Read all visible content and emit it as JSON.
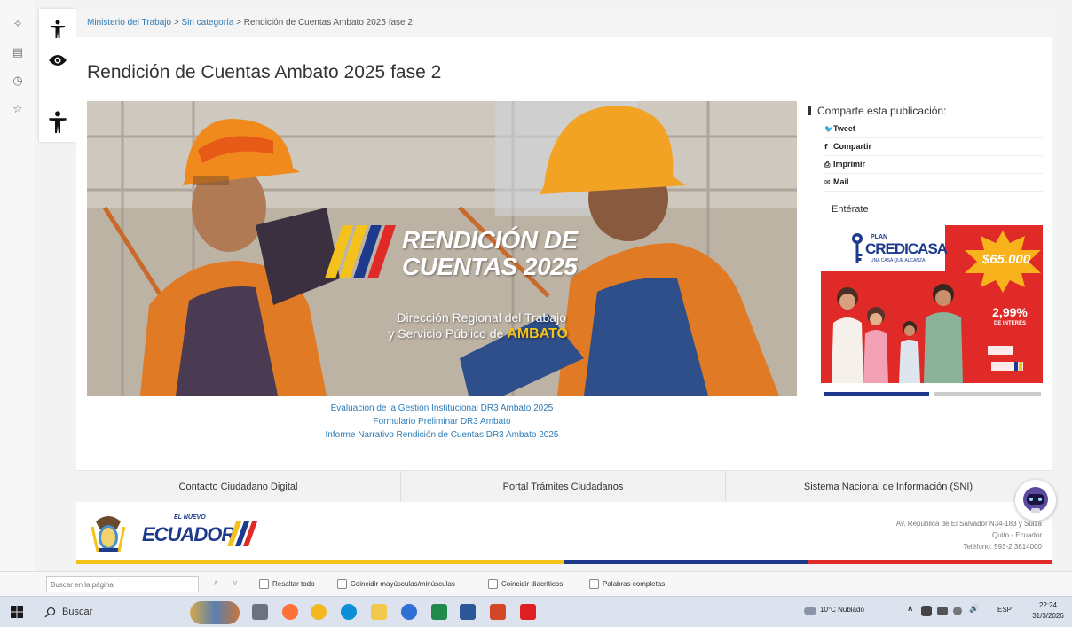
{
  "breadcrumb": {
    "item1": "Ministerio del Trabajo",
    "sep": " > ",
    "item2": "Sin categoría",
    "current": "Rendición de Cuentas Ambato 2025 fase 2"
  },
  "page_title": "Rendición de Cuentas Ambato 2025 fase 2",
  "hero": {
    "title_line1": "RENDICIÓN DE",
    "title_line2": "CUENTAS 2025",
    "subtitle_line1": "Dirección Regional del Trabajo",
    "subtitle_line2": "y Servicio Público de ",
    "subtitle_highlight": "AMBATO"
  },
  "doc_links": [
    "Evaluación de la Gestión Institucional DR3 Ambato 2025",
    "Formulario Preliminar DR3 Ambato",
    "Informe Narrativo Rendición de Cuentas DR3 Ambato 2025"
  ],
  "share": {
    "heading": "Comparte esta publicación:",
    "items": [
      {
        "icon": "twitter-icon",
        "label": "Tweet"
      },
      {
        "icon": "facebook-icon",
        "label": "Compartir"
      },
      {
        "icon": "print-icon",
        "label": "Imprimir"
      },
      {
        "icon": "mail-icon",
        "label": "Mail"
      }
    ]
  },
  "enterate": "Entérate",
  "ad": {
    "plan": "PLAN",
    "brand": "CREDICASA",
    "tagline": "UNA CASA QUE ALCANZA",
    "amount": "$65.000",
    "rate": "2,99%",
    "rate_label": "DE INTERÉS"
  },
  "footer_nav": [
    "Contacto Ciudadano Digital",
    "Portal Trámites Ciudadanos",
    "Sistema Nacional de Información (SNI)"
  ],
  "footer_brand": {
    "logo_top": "EL NUEVO",
    "logo_text": "ECUADOR",
    "address1": "Av. República de El Salvador N34-183 y Súiza",
    "address2": "Quito - Ecuador",
    "phone": "Teléfono: 593-2 3814000"
  },
  "find_bar": {
    "placeholder": "Buscar en la página",
    "options": [
      "Resaltar todo",
      "Coincidir mayúsculas/minúsculas",
      "Coincidir diacríticos",
      "Palabras completas"
    ]
  },
  "taskbar": {
    "search": "Buscar",
    "weather": "10°C  Nublado",
    "lang": "ESP",
    "time": "22:24",
    "date": "31/3/2026"
  },
  "colors": {
    "link": "#2d7bb6",
    "flag_yellow": "#f4c21a",
    "flag_blue": "#1d3a8c",
    "flag_red": "#e02a28",
    "ad_red": "#e02a28"
  }
}
